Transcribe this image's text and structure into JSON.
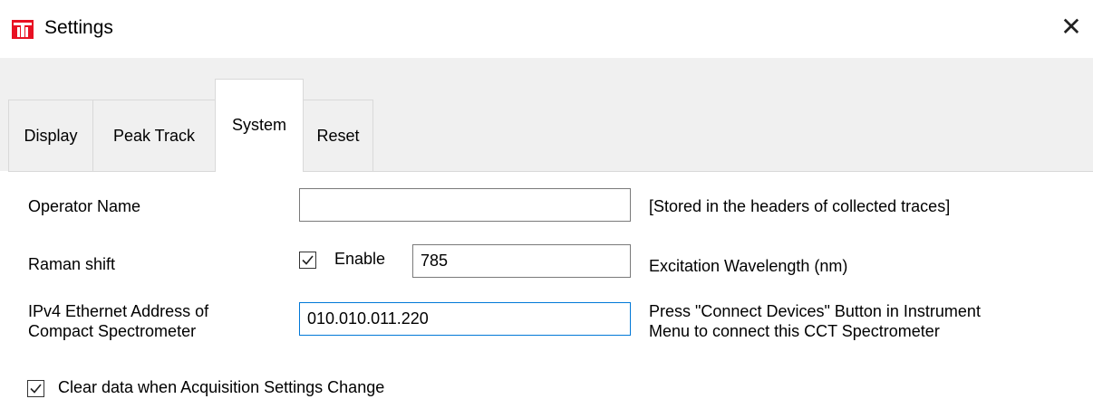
{
  "window": {
    "title": "Settings",
    "app_icon": "red-t-logo-icon",
    "close_icon": "close-icon",
    "close_glyph": "✕"
  },
  "tabs": [
    {
      "label": "Display",
      "active": false
    },
    {
      "label": "Peak Track",
      "active": false
    },
    {
      "label": "System",
      "active": true
    },
    {
      "label": "Reset",
      "active": false
    }
  ],
  "system": {
    "operator_name": {
      "label": "Operator Name",
      "value": "",
      "note": "[Stored in the headers of collected traces]"
    },
    "raman_shift": {
      "label": "Raman shift",
      "enable_label": "Enable",
      "enabled": true,
      "wavelength_value": "785",
      "wavelength_label": "Excitation Wavelength (nm)"
    },
    "ipv4": {
      "label_line1": "IPv4 Ethernet Address of",
      "label_line2": "Compact Spectrometer",
      "value": "010.010.011.220",
      "note_line1": "Press \"Connect Devices\" Button in Instrument",
      "note_line2": "Menu to connect this CCT Spectrometer"
    },
    "clear_data": {
      "label": "Clear data when Acquisition Settings Change",
      "checked": true
    }
  },
  "colors": {
    "accent": "#0078d7",
    "logo_red": "#e81123",
    "tab_bg": "#f0f0f0"
  }
}
